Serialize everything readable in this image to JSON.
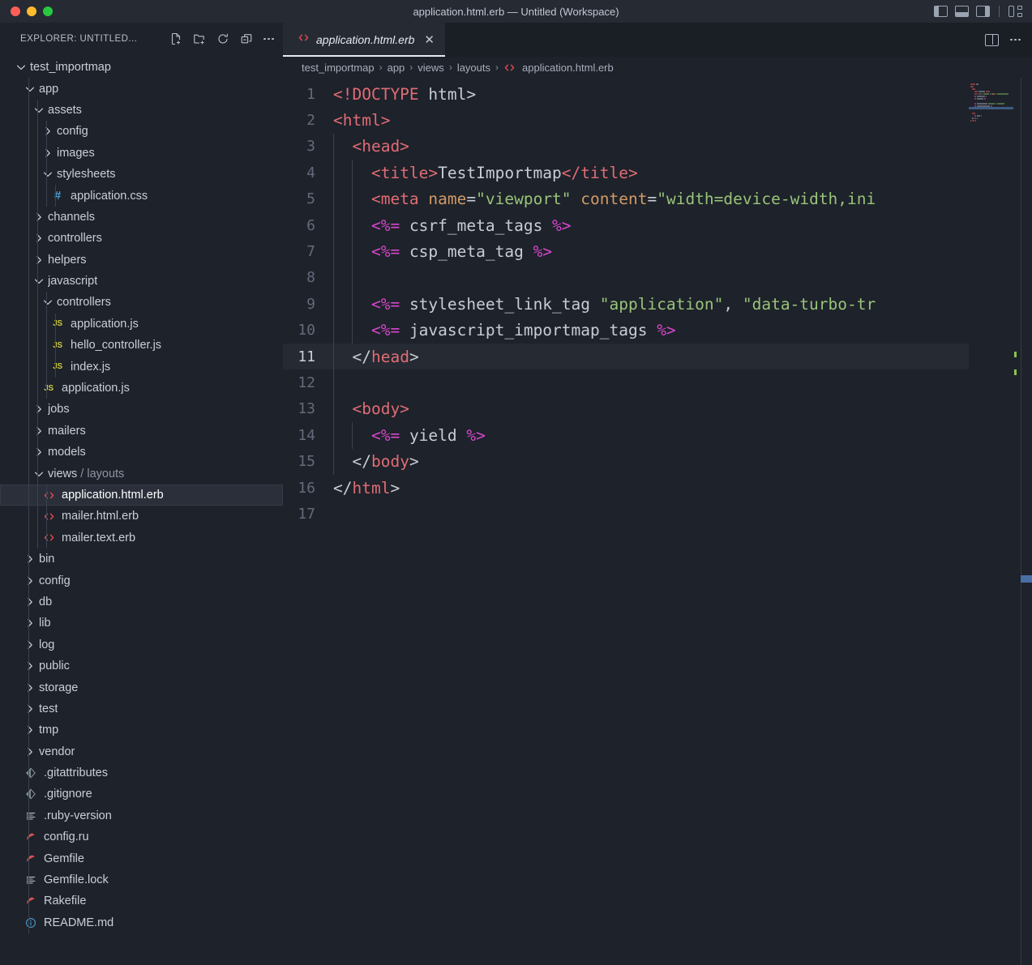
{
  "titlebar": {
    "title": "application.html.erb — Untitled (Workspace)",
    "traffic_lights": [
      "close-red",
      "minimize-yellow",
      "maximize-green"
    ],
    "layout_icons": [
      "toggle-primary-sidebar",
      "toggle-panel",
      "toggle-secondary-sidebar",
      "customize-layout"
    ],
    "colors": {
      "red": "#ff5f57",
      "yellow": "#febc2e",
      "green": "#28c840"
    }
  },
  "explorer": {
    "title": "EXPLORER: UNTITLED...",
    "actions": [
      "new-file-icon",
      "new-folder-icon",
      "refresh-icon",
      "collapse-all-icon",
      "more-actions-icon"
    ],
    "tree": [
      {
        "label": "test_importmap",
        "depth": 0,
        "type": "folder",
        "state": "expanded"
      },
      {
        "label": "app",
        "depth": 1,
        "type": "folder",
        "state": "expanded"
      },
      {
        "label": "assets",
        "depth": 2,
        "type": "folder",
        "state": "expanded"
      },
      {
        "label": "config",
        "depth": 3,
        "type": "folder",
        "state": "collapsed"
      },
      {
        "label": "images",
        "depth": 3,
        "type": "folder",
        "state": "collapsed"
      },
      {
        "label": "stylesheets",
        "depth": 3,
        "type": "folder",
        "state": "expanded"
      },
      {
        "label": "application.css",
        "depth": 4,
        "type": "file",
        "icon": "css-hash-icon"
      },
      {
        "label": "channels",
        "depth": 2,
        "type": "folder",
        "state": "collapsed"
      },
      {
        "label": "controllers",
        "depth": 2,
        "type": "folder",
        "state": "collapsed"
      },
      {
        "label": "helpers",
        "depth": 2,
        "type": "folder",
        "state": "collapsed"
      },
      {
        "label": "javascript",
        "depth": 2,
        "type": "folder",
        "state": "expanded"
      },
      {
        "label": "controllers",
        "depth": 3,
        "type": "folder",
        "state": "expanded"
      },
      {
        "label": "application.js",
        "depth": 4,
        "type": "file",
        "icon": "js-icon"
      },
      {
        "label": "hello_controller.js",
        "depth": 4,
        "type": "file",
        "icon": "js-icon"
      },
      {
        "label": "index.js",
        "depth": 4,
        "type": "file",
        "icon": "js-icon"
      },
      {
        "label": "application.js",
        "depth": 3,
        "type": "file",
        "icon": "js-icon"
      },
      {
        "label": "jobs",
        "depth": 2,
        "type": "folder",
        "state": "collapsed"
      },
      {
        "label": "mailers",
        "depth": 2,
        "type": "folder",
        "state": "collapsed"
      },
      {
        "label": "models",
        "depth": 2,
        "type": "folder",
        "state": "collapsed"
      },
      {
        "label": "views",
        "sublabel": "/ layouts",
        "depth": 2,
        "type": "folder",
        "state": "expanded"
      },
      {
        "label": "application.html.erb",
        "depth": 3,
        "type": "file",
        "icon": "erb-icon",
        "selected": true
      },
      {
        "label": "mailer.html.erb",
        "depth": 3,
        "type": "file",
        "icon": "erb-icon"
      },
      {
        "label": "mailer.text.erb",
        "depth": 3,
        "type": "file",
        "icon": "erb-icon"
      },
      {
        "label": "bin",
        "depth": 1,
        "type": "folder",
        "state": "collapsed"
      },
      {
        "label": "config",
        "depth": 1,
        "type": "folder",
        "state": "collapsed"
      },
      {
        "label": "db",
        "depth": 1,
        "type": "folder",
        "state": "collapsed"
      },
      {
        "label": "lib",
        "depth": 1,
        "type": "folder",
        "state": "collapsed"
      },
      {
        "label": "log",
        "depth": 1,
        "type": "folder",
        "state": "collapsed"
      },
      {
        "label": "public",
        "depth": 1,
        "type": "folder",
        "state": "collapsed"
      },
      {
        "label": "storage",
        "depth": 1,
        "type": "folder",
        "state": "collapsed"
      },
      {
        "label": "test",
        "depth": 1,
        "type": "folder",
        "state": "collapsed"
      },
      {
        "label": "tmp",
        "depth": 1,
        "type": "folder",
        "state": "collapsed"
      },
      {
        "label": "vendor",
        "depth": 1,
        "type": "folder",
        "state": "collapsed"
      },
      {
        "label": ".gitattributes",
        "depth": 1,
        "type": "file",
        "icon": "git-icon"
      },
      {
        "label": ".gitignore",
        "depth": 1,
        "type": "file",
        "icon": "git-icon"
      },
      {
        "label": ".ruby-version",
        "depth": 1,
        "type": "file",
        "icon": "text-lines-icon"
      },
      {
        "label": "config.ru",
        "depth": 1,
        "type": "file",
        "icon": "ruby-icon"
      },
      {
        "label": "Gemfile",
        "depth": 1,
        "type": "file",
        "icon": "ruby-icon"
      },
      {
        "label": "Gemfile.lock",
        "depth": 1,
        "type": "file",
        "icon": "text-lines-icon"
      },
      {
        "label": "Rakefile",
        "depth": 1,
        "type": "file",
        "icon": "ruby-icon"
      },
      {
        "label": "README.md",
        "depth": 1,
        "type": "file",
        "icon": "info-icon"
      }
    ]
  },
  "editor": {
    "tab": {
      "label": "application.html.erb",
      "icon": "erb-icon",
      "close": "✕",
      "preview": true
    },
    "tab_actions": [
      "split-editor-icon",
      "more-actions-icon"
    ],
    "breadcrumb": [
      "test_importmap",
      "app",
      "views",
      "layouts",
      "application.html.erb"
    ],
    "breadcrumb_separator": "›",
    "active_line": 11,
    "total_lines": 17,
    "lines": [
      {
        "n": 1,
        "indent": 0,
        "tokens": [
          {
            "t": "tag",
            "v": "<!DOCTYPE"
          },
          {
            "t": "txt",
            "v": " html>"
          }
        ]
      },
      {
        "n": 2,
        "indent": 0,
        "tokens": [
          {
            "t": "tag",
            "v": "<html>"
          }
        ]
      },
      {
        "n": 3,
        "indent": 1,
        "tokens": [
          {
            "t": "tag",
            "v": "<head>"
          }
        ]
      },
      {
        "n": 4,
        "indent": 2,
        "tokens": [
          {
            "t": "tag",
            "v": "<title>"
          },
          {
            "t": "txt",
            "v": "TestImportmap"
          },
          {
            "t": "tag",
            "v": "</title>"
          }
        ]
      },
      {
        "n": 5,
        "indent": 2,
        "tokens": [
          {
            "t": "tag",
            "v": "<meta"
          },
          {
            "t": "txt",
            "v": " "
          },
          {
            "t": "attr",
            "v": "name"
          },
          {
            "t": "txt",
            "v": "="
          },
          {
            "t": "str",
            "v": "\"viewport\""
          },
          {
            "t": "txt",
            "v": " "
          },
          {
            "t": "attr",
            "v": "content"
          },
          {
            "t": "txt",
            "v": "="
          },
          {
            "t": "str",
            "v": "\"width=device-width,ini"
          }
        ]
      },
      {
        "n": 6,
        "indent": 2,
        "tokens": [
          {
            "t": "erb",
            "v": "<%="
          },
          {
            "t": "txt",
            "v": " csrf_meta_tags "
          },
          {
            "t": "erb",
            "v": "%>"
          }
        ]
      },
      {
        "n": 7,
        "indent": 2,
        "tokens": [
          {
            "t": "erb",
            "v": "<%="
          },
          {
            "t": "txt",
            "v": " csp_meta_tag "
          },
          {
            "t": "erb",
            "v": "%>"
          }
        ]
      },
      {
        "n": 8,
        "indent": 2,
        "tokens": []
      },
      {
        "n": 9,
        "indent": 2,
        "tokens": [
          {
            "t": "erb",
            "v": "<%="
          },
          {
            "t": "txt",
            "v": " stylesheet_link_tag "
          },
          {
            "t": "str",
            "v": "\"application\""
          },
          {
            "t": "txt",
            "v": ", "
          },
          {
            "t": "str",
            "v": "\"data-turbo-tr"
          }
        ]
      },
      {
        "n": 10,
        "indent": 2,
        "tokens": [
          {
            "t": "erb",
            "v": "<%="
          },
          {
            "t": "txt",
            "v": " javascript_importmap_tags "
          },
          {
            "t": "erb",
            "v": "%>"
          }
        ]
      },
      {
        "n": 11,
        "indent": 1,
        "tokens": [
          {
            "t": "txt",
            "v": "</"
          },
          {
            "t": "tag",
            "v": "head"
          },
          {
            "t": "txt",
            "v": ">"
          }
        ]
      },
      {
        "n": 12,
        "indent": 0,
        "tokens": []
      },
      {
        "n": 13,
        "indent": 1,
        "tokens": [
          {
            "t": "tag",
            "v": "<body>"
          }
        ]
      },
      {
        "n": 14,
        "indent": 2,
        "tokens": [
          {
            "t": "erb",
            "v": "<%="
          },
          {
            "t": "txt",
            "v": " yield "
          },
          {
            "t": "erb",
            "v": "%>"
          }
        ]
      },
      {
        "n": 15,
        "indent": 1,
        "tokens": [
          {
            "t": "txt",
            "v": "</"
          },
          {
            "t": "tag",
            "v": "body"
          },
          {
            "t": "txt",
            "v": ">"
          }
        ]
      },
      {
        "n": 16,
        "indent": 0,
        "tokens": [
          {
            "t": "txt",
            "v": "</"
          },
          {
            "t": "tag",
            "v": "html"
          },
          {
            "t": "txt",
            "v": ">"
          }
        ]
      },
      {
        "n": 17,
        "indent": 0,
        "tokens": []
      }
    ],
    "syntax_colors": {
      "tag": "#e06c75",
      "text": "#c8ccd4",
      "attribute": "#d19a66",
      "string": "#98c379",
      "erb": "#d946cf",
      "line_number": "#636b7a",
      "background": "#1e222a",
      "active_line_bg": "#252a33"
    },
    "minimap": {
      "visible": true,
      "cursor_line": 11
    },
    "scrollbar": {
      "slider_color": "#4a6fa5",
      "overview_marks": 2
    }
  }
}
